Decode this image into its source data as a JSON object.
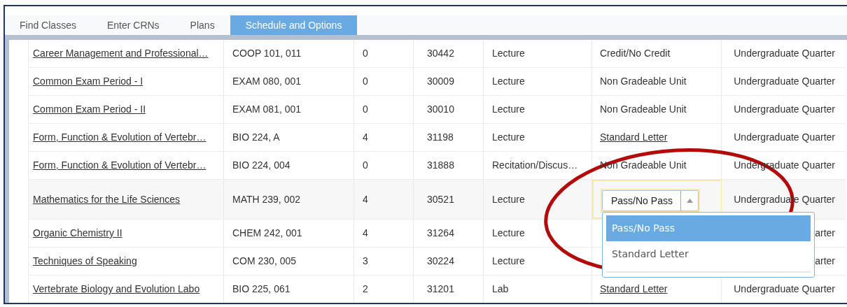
{
  "tabs": [
    {
      "label": "Find Classes",
      "selected": false
    },
    {
      "label": "Enter CRNs",
      "selected": false
    },
    {
      "label": "Plans",
      "selected": false
    },
    {
      "label": "Schedule and Options",
      "selected": true
    }
  ],
  "rows": [
    {
      "title": "Career Management and Professional…",
      "course": "COOP 101, 011",
      "credits": "0",
      "crn": "30442",
      "schedule_type": "Lecture",
      "grading": {
        "kind": "text",
        "text": "Credit/No Credit"
      },
      "level": "Undergraduate Quarter"
    },
    {
      "title": "Common Exam Period - I",
      "course": "EXAM 080, 001",
      "credits": "0",
      "crn": "30009",
      "schedule_type": "Lecture",
      "grading": {
        "kind": "text",
        "text": "Non Gradeable Unit"
      },
      "level": "Undergraduate Quarter"
    },
    {
      "title": "Common Exam Period - II",
      "course": "EXAM 081, 001",
      "credits": "0",
      "crn": "30010",
      "schedule_type": "Lecture",
      "grading": {
        "kind": "text",
        "text": "Non Gradeable Unit"
      },
      "level": "Undergraduate Quarter"
    },
    {
      "title": "Form, Function & Evolution of Vertebr…",
      "course": "BIO 224, A",
      "credits": "4",
      "crn": "31198",
      "schedule_type": "Lecture",
      "grading": {
        "kind": "link",
        "text": "Standard Letter"
      },
      "level": "Undergraduate Quarter"
    },
    {
      "title": "Form, Function & Evolution of Vertebr…",
      "course": "BIO 224, 004",
      "credits": "0",
      "crn": "31888",
      "schedule_type": "Recitation/Discus…",
      "grading": {
        "kind": "text",
        "text": "Non Gradeable Unit"
      },
      "level": "Undergraduate Quarter"
    },
    {
      "title": "Mathematics for the Life Sciences",
      "course": "MATH 239, 002",
      "credits": "4",
      "crn": "30521",
      "schedule_type": "Lecture",
      "grading": {
        "kind": "select",
        "value": "Pass/No Pass",
        "expanded": true,
        "options": [
          {
            "label": "Pass/No Pass",
            "selected": true
          },
          {
            "label": "Standard Letter",
            "selected": false
          }
        ]
      },
      "level": "Undergraduate Quarter"
    },
    {
      "title": "Organic Chemistry II",
      "course": "CHEM 242, 001",
      "credits": "4",
      "crn": "31264",
      "schedule_type": "Lecture",
      "level": "arter"
    },
    {
      "title": "Techniques of Speaking",
      "course": "COM 230, 005",
      "credits": "3",
      "crn": "30224",
      "schedule_type": "Lecture",
      "level": "arter"
    },
    {
      "title": "Vertebrate Biology and Evolution Labo",
      "course": "BIO 225, 061",
      "credits": "2",
      "crn": "31201",
      "schedule_type": "Lab",
      "grading": {
        "kind": "link",
        "text": "Standard Letter"
      },
      "level": "Undergraduate Quarter"
    }
  ]
}
